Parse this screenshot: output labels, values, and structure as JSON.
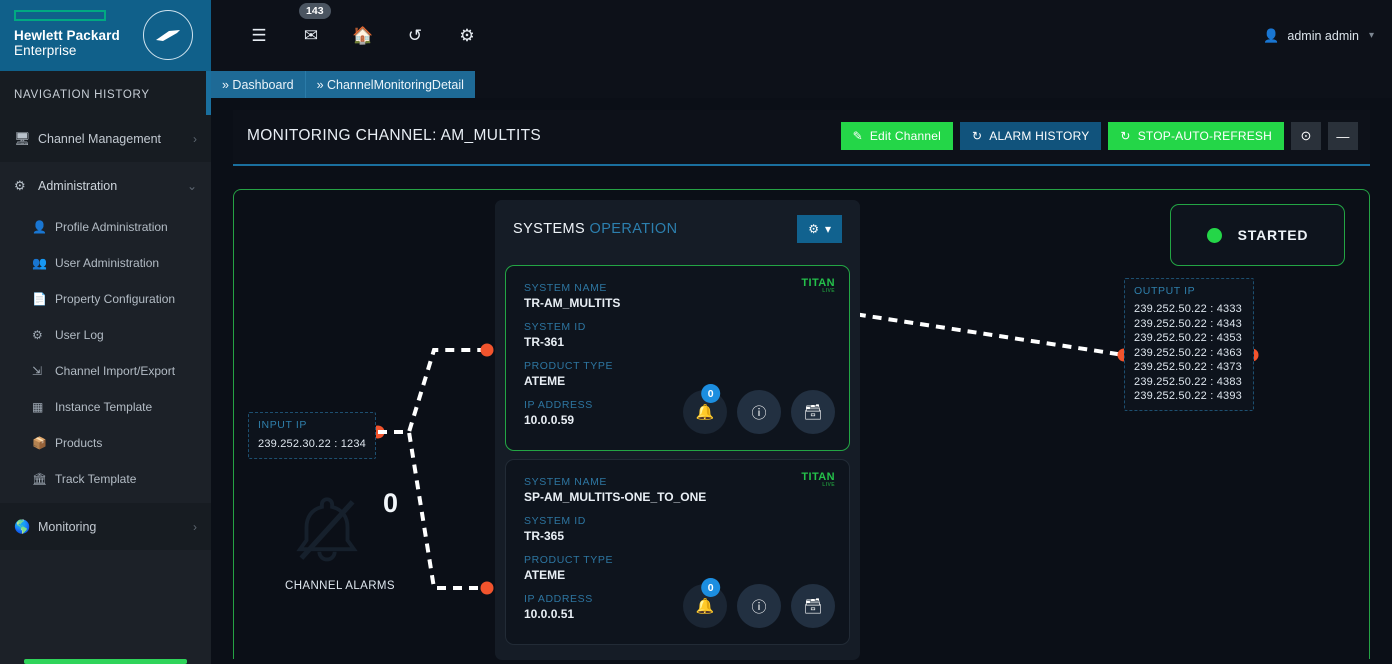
{
  "brand": {
    "name_line1": "Hewlett Packard",
    "name_line2": "Enterprise"
  },
  "sidebar": {
    "history_label": "NAVIGATION HISTORY",
    "history_items": [
      {
        "label": "Channel Management",
        "icon": "monitor-icon"
      }
    ],
    "sections": [
      {
        "label": "Administration",
        "icon": "gears-icon",
        "items": [
          {
            "label": "Profile Administration",
            "icon": "profile-icon"
          },
          {
            "label": "User Administration",
            "icon": "users-icon"
          },
          {
            "label": "Property Configuration",
            "icon": "document-icon"
          },
          {
            "label": "User Log",
            "icon": "log-icon"
          },
          {
            "label": "Channel Import/Export",
            "icon": "import-export-icon"
          },
          {
            "label": "Instance Template",
            "icon": "template-icon"
          },
          {
            "label": "Products",
            "icon": "box-icon"
          },
          {
            "label": "Track Template",
            "icon": "bank-icon"
          }
        ]
      },
      {
        "label": "Monitoring",
        "icon": "globe-icon",
        "items": []
      }
    ]
  },
  "topbar": {
    "menu_icon": "hamburger-icon",
    "mail_icon": "envelope-icon",
    "mail_badge": "143",
    "home_icon": "home-icon",
    "refresh_icon": "refresh-icon",
    "settings_icon": "gear-icon",
    "user": "admin admin"
  },
  "breadcrumb": [
    "» Dashboard",
    "» ChannelMonitoringDetail"
  ],
  "page": {
    "title": "MONITORING CHANNEL: AM_MULTITS",
    "actions": [
      {
        "label": "Edit Channel",
        "icon": "edit-icon",
        "style": "green"
      },
      {
        "label": "ALARM HISTORY",
        "icon": "history-icon",
        "style": "blue"
      },
      {
        "label": "STOP-AUTO-REFRESH",
        "icon": "refresh-icon",
        "style": "green"
      }
    ],
    "icon_buttons": [
      {
        "icon": "expand-icon",
        "label": "⊙"
      },
      {
        "icon": "minimize-icon",
        "label": "—"
      }
    ]
  },
  "diagram": {
    "status": {
      "label": "STARTED",
      "color": "#24d648"
    },
    "input_ip": {
      "title": "INPUT IP",
      "values": [
        "239.252.30.22 : 1234"
      ]
    },
    "output_ip": {
      "title": "OUTPUT IP",
      "values": [
        "239.252.50.22 : 4333",
        "239.252.50.22 : 4343",
        "239.252.50.22 : 4353",
        "239.252.50.22 : 4363",
        "239.252.50.22 : 4373",
        "239.252.50.22 : 4383",
        "239.252.50.22 : 4393"
      ]
    },
    "channel_alarms": {
      "label": "CHANNEL ALARMS",
      "count": "0",
      "icon": "bell-slash-icon"
    },
    "systems_panel": {
      "title_main": "SYSTEMS",
      "title_sub": "OPERATION",
      "gear_button_icon": "gear-icon",
      "cards": [
        {
          "logo": "TITAN",
          "logo_sub": "LIVE",
          "state": "active",
          "fields": [
            {
              "label": "SYSTEM NAME",
              "value": "TR-AM_MULTITS"
            },
            {
              "label": "SYSTEM ID",
              "value": "TR-361"
            },
            {
              "label": "PRODUCT TYPE",
              "value": "ATEME"
            },
            {
              "label": "IP ADDRESS",
              "value": "10.0.0.59"
            }
          ],
          "actions": [
            {
              "icon": "bell-slash-icon",
              "badge": "0"
            },
            {
              "icon": "info-icon",
              "badge": ""
            },
            {
              "icon": "database-icon",
              "badge": ""
            }
          ]
        },
        {
          "logo": "TITAN",
          "logo_sub": "LIVE",
          "state": "idle",
          "fields": [
            {
              "label": "SYSTEM NAME",
              "value": "SP-AM_MULTITS-ONE_TO_ONE"
            },
            {
              "label": "SYSTEM ID",
              "value": "TR-365"
            },
            {
              "label": "PRODUCT TYPE",
              "value": "ATEME"
            },
            {
              "label": "IP ADDRESS",
              "value": "10.0.0.51"
            }
          ],
          "actions": [
            {
              "icon": "bell-slash-icon",
              "badge": "0"
            },
            {
              "icon": "info-icon",
              "badge": ""
            },
            {
              "icon": "database-icon",
              "badge": ""
            }
          ]
        }
      ]
    }
  }
}
